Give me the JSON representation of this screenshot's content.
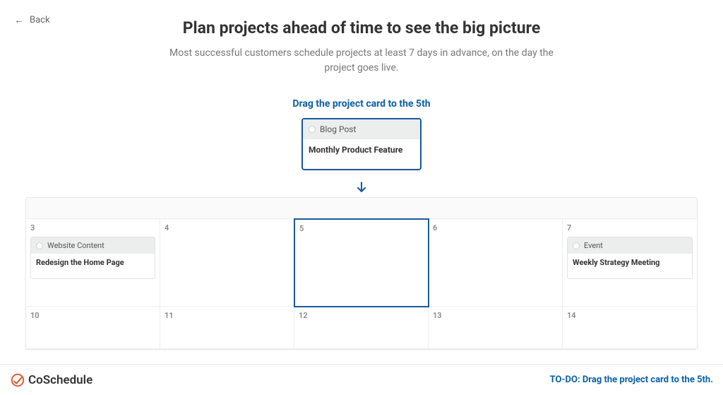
{
  "nav": {
    "back_label": "Back"
  },
  "header": {
    "title": "Plan projects ahead of time to see the big picture",
    "subtitle": "Most successful customers schedule projects at least 7 days in advance, on the day the project goes live."
  },
  "instruction": "Drag the project card to the 5th",
  "drag_card": {
    "type_label": "Blog Post",
    "title": "Monthly Product Feature"
  },
  "calendar": {
    "row1": [
      {
        "day": "3",
        "card": {
          "type_label": "Website Content",
          "title": "Redesign the Home Page"
        }
      },
      {
        "day": "4"
      },
      {
        "day": "5",
        "highlighted": true
      },
      {
        "day": "6"
      },
      {
        "day": "7",
        "card": {
          "type_label": "Event",
          "title": "Weekly Strategy Meeting"
        }
      }
    ],
    "row2": [
      {
        "day": "10"
      },
      {
        "day": "11"
      },
      {
        "day": "12"
      },
      {
        "day": "13"
      },
      {
        "day": "14"
      }
    ]
  },
  "footer": {
    "logo_text": "CoSchedule",
    "todo": "TO-DO: Drag the project card to the 5th."
  }
}
